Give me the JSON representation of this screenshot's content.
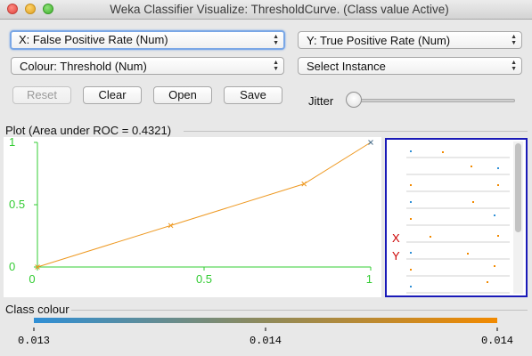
{
  "window": {
    "title": "Weka Classifier Visualize: ThresholdCurve. (Class value Active)"
  },
  "controls": {
    "x_axis": "X: False Positive Rate (Num)",
    "y_axis": "Y: True Positive Rate (Num)",
    "colour": "Colour: Threshold (Num)",
    "instance": "Select Instance",
    "reset": "Reset",
    "clear": "Clear",
    "open": "Open",
    "save": "Save",
    "jitter": "Jitter",
    "jitter_value": 0
  },
  "plot": {
    "title": "Plot (Area under ROC = 0.4321)",
    "bg": "#ffffff",
    "axis_color": "#33cc33",
    "line_color": "#ee9922"
  },
  "chart_data": {
    "type": "line",
    "title": "Plot (Area under ROC = 0.4321)",
    "xlabel": "",
    "ylabel": "",
    "x_ticks": [
      "0",
      "0.5",
      "1"
    ],
    "y_ticks": [
      "0",
      "0.5",
      "1"
    ],
    "xlim": [
      0,
      1
    ],
    "ylim": [
      0,
      1
    ],
    "grid": false,
    "x": [
      0,
      0.4,
      0.8,
      1
    ],
    "y": [
      0,
      0.333,
      0.667,
      1
    ],
    "marker": "x",
    "series_color": "#ee9922"
  },
  "legend": {
    "x_label": "X",
    "y_label": "Y",
    "label_color": "#cc0000"
  },
  "class_colour": {
    "title": "Class colour",
    "ticks": [
      "0.013",
      "0.014",
      "0.014"
    ],
    "gradient_start": "#2f8fd6",
    "gradient_end": "#f28a00"
  }
}
